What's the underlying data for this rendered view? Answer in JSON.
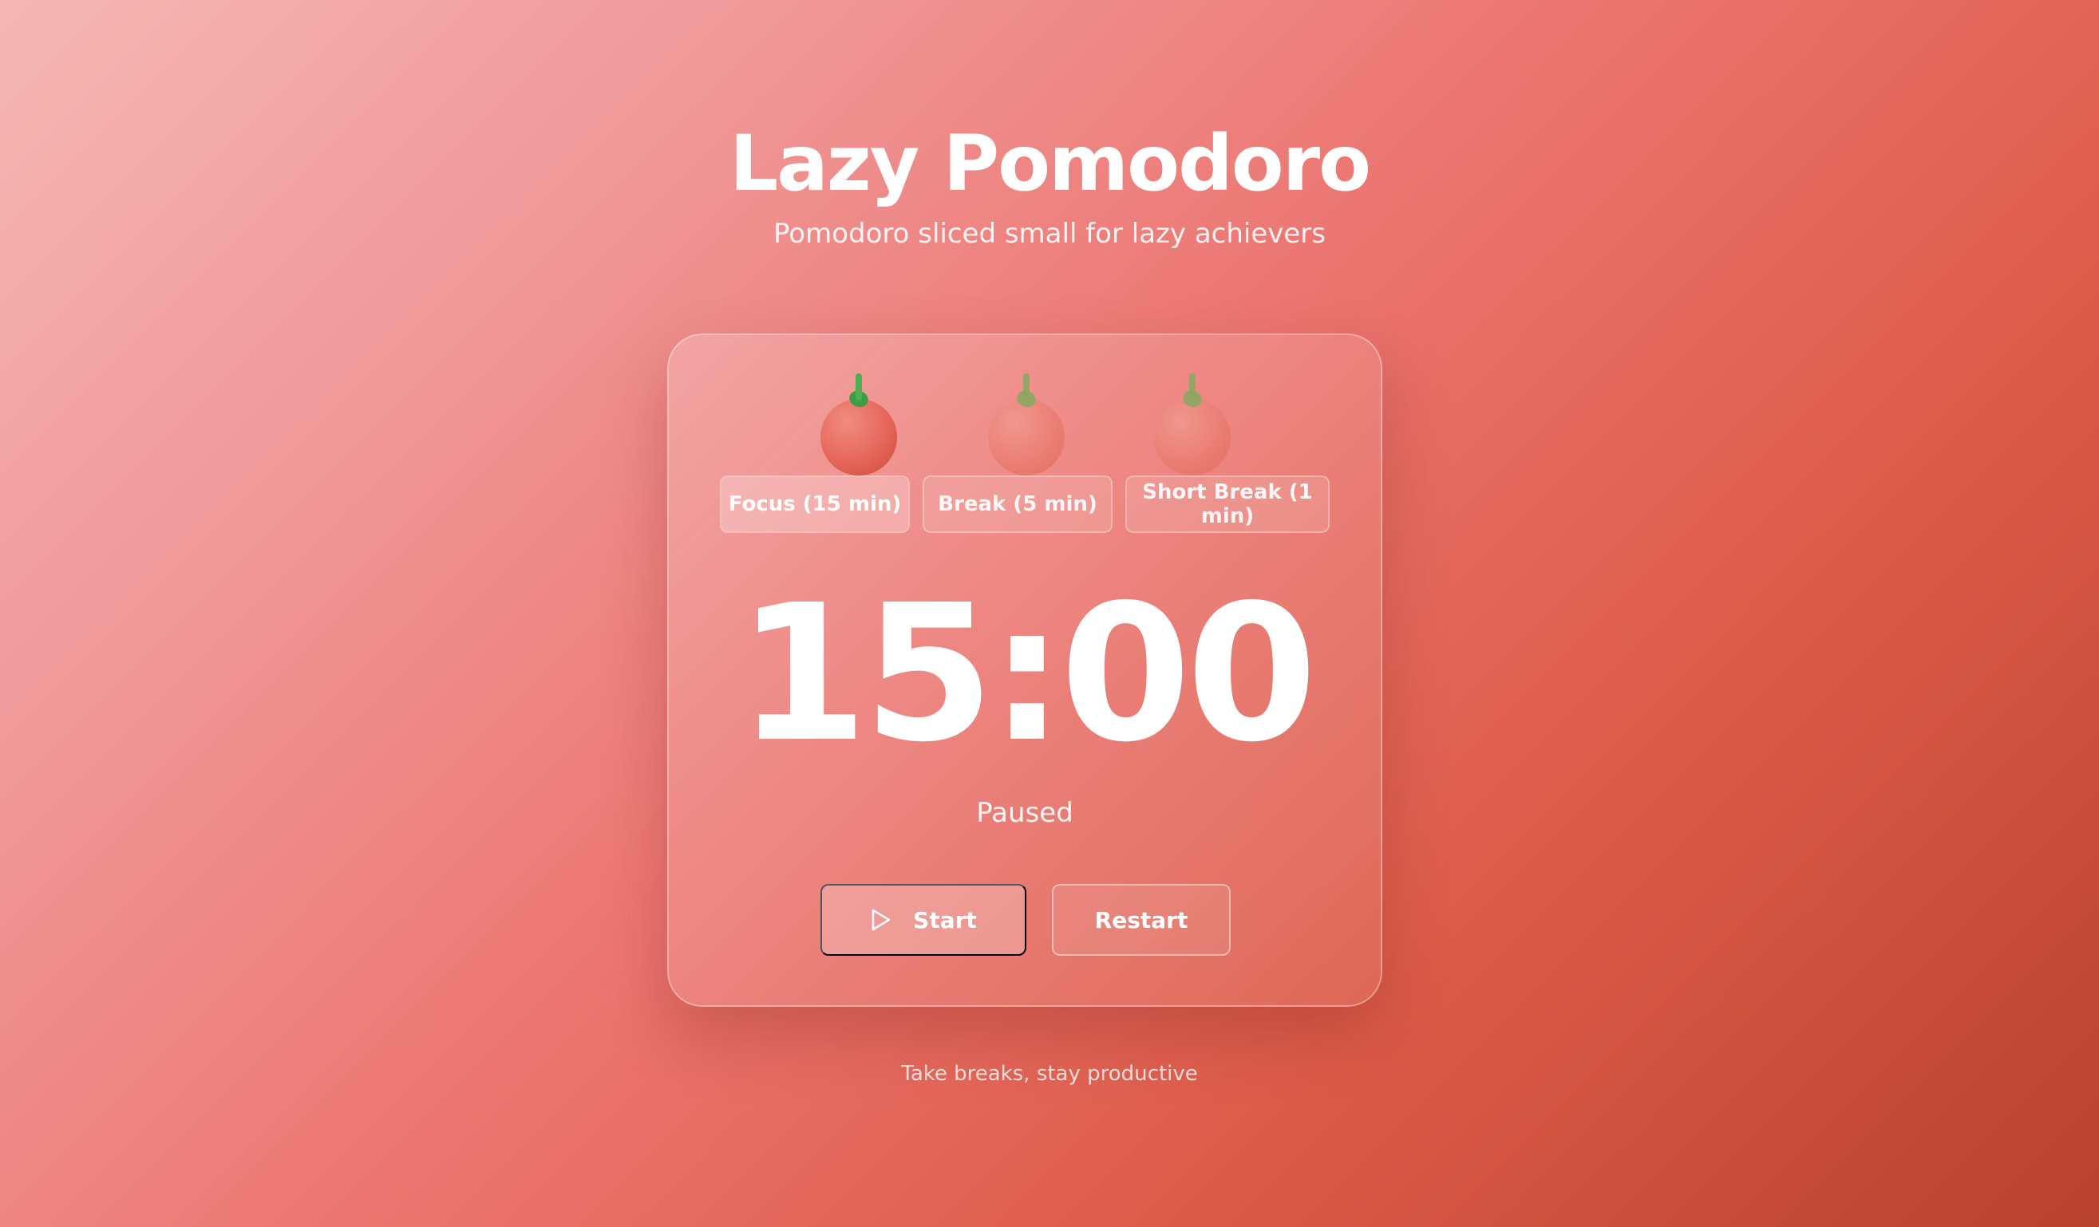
{
  "header": {
    "title": "Lazy Pomodoro",
    "subtitle": "Pomodoro sliced small for lazy achievers"
  },
  "tomatoes": [
    {
      "icon": "tomato-icon",
      "state": "active"
    },
    {
      "icon": "tomato-icon",
      "state": "inactive"
    },
    {
      "icon": "tomato-icon",
      "state": "inactive"
    }
  ],
  "modes": [
    {
      "label": "Focus (15 min)",
      "active": true
    },
    {
      "label": "Break (5 min)",
      "active": false
    },
    {
      "label": "Short Break (1 min)",
      "active": false
    }
  ],
  "timer": {
    "display": "15:00",
    "status": "Paused"
  },
  "actions": {
    "start_label": "Start",
    "start_icon": "play-icon",
    "restart_label": "Restart"
  },
  "footer": {
    "tagline": "Take breaks, stay productive"
  },
  "colors": {
    "gradient_start": "#f5b8b4",
    "gradient_mid": "#ec7570",
    "gradient_end": "#b8412f",
    "tomato": "#e6665a",
    "stem": "#4caf50"
  }
}
